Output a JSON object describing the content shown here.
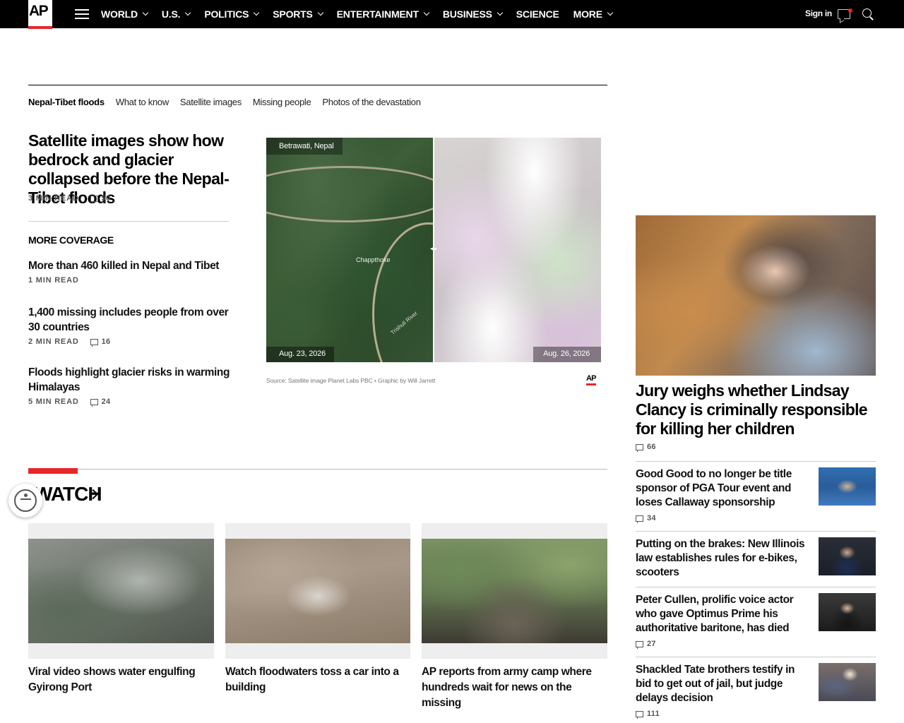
{
  "nav": {
    "logo": "AP",
    "items": [
      "WORLD",
      "U.S.",
      "POLITICS",
      "SPORTS",
      "ENTERTAINMENT",
      "BUSINESS",
      "SCIENCE",
      "MORE"
    ],
    "sign_in": "Sign in"
  },
  "topic_nav": {
    "items": [
      "Nepal-Tibet floods",
      "What to know",
      "Satellite images",
      "Missing people",
      "Photos of the devastation"
    ]
  },
  "lead": {
    "headline": "Satellite images show how bedrock and glacier collapsed before the Nepal-Tibet floods",
    "read_time": "3 MIN READ",
    "comments": "50"
  },
  "more_coverage": {
    "label": "MORE COVERAGE",
    "items": [
      {
        "headline": "More than 460 killed in Nepal and Tibet",
        "read_time": "1 MIN READ",
        "comments": ""
      },
      {
        "headline": "1,400 missing includes people from over 30 countries",
        "read_time": "2 MIN READ",
        "comments": "16"
      },
      {
        "headline": "Floods highlight glacier risks in warming Himalayas",
        "read_time": "5 MIN READ",
        "comments": "24"
      }
    ]
  },
  "graphic": {
    "location": "Betrawati, Nepal",
    "place": "Chappthoke",
    "river": "Trishuli River",
    "date_before": "Aug. 23, 2026",
    "date_after": "Aug. 26, 2026",
    "source": "Source: Satellite image Planet Labs PBC • Graphic by Will Jarrett",
    "credit": "AP",
    "handle": "◂▸"
  },
  "watch": {
    "title": "WATCH",
    "videos": [
      {
        "title": "Viral video shows water engulfing Gyirong Port"
      },
      {
        "title": "Watch floodwaters toss a car into a building"
      },
      {
        "title": "AP reports from army camp where hundreds wait for news on the missing"
      }
    ]
  },
  "rail": {
    "headline": "Jury weighs whether Lindsay Clancy is criminally responsible for killing her children",
    "comments": "66",
    "items": [
      {
        "headline": "Good Good to no longer be title sponsor of PGA Tour event and loses Callaway sponsorship",
        "comments": "34"
      },
      {
        "headline": "Putting on the brakes: New Illinois law establishes rules for e-bikes, scooters",
        "comments": ""
      },
      {
        "headline": "Peter Cullen, prolific voice actor who gave Optimus Prime his authoritative baritone, has died",
        "comments": "27"
      },
      {
        "headline": "Shackled Tate brothers testify in bid to get out of jail, but judge delays decision",
        "comments": "111"
      }
    ]
  },
  "colors": {
    "accent": "#e8262a",
    "nav_bg": "#000000"
  }
}
